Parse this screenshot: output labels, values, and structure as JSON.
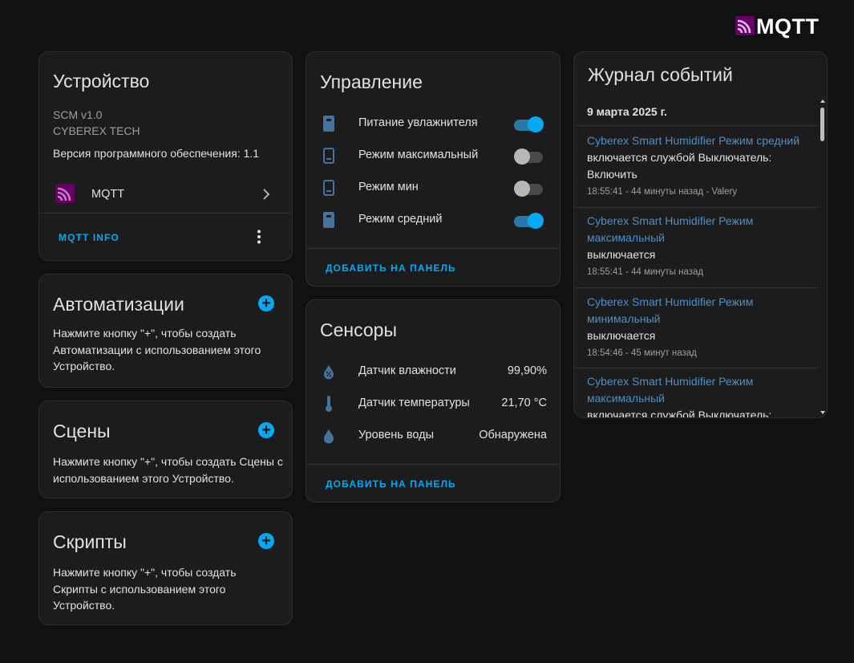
{
  "brand": {
    "logo_text": "MQTT"
  },
  "device_card": {
    "title": "Устройство",
    "model": "SCM v1.0",
    "manufacturer": "CYBEREX TECH",
    "firmware": "Версия программного обеспечения: 1.1",
    "integration_label": "MQTT",
    "info_button": "MQTT INFO"
  },
  "automations_card": {
    "title": "Автоматизации",
    "description": "Нажмите кнопку \"+\", чтобы создать Автоматизации с использованием этого Устройство."
  },
  "scenes_card": {
    "title": "Сцены",
    "description": "Нажмите кнопку \"+\", чтобы создать Сцены с использованием этого Устройство."
  },
  "scripts_card": {
    "title": "Скрипты",
    "description": "Нажмите кнопку \"+\", чтобы создать Скрипты с использованием этого Устройство."
  },
  "controls_card": {
    "title": "Управление",
    "items": [
      {
        "label": "Питание увлажнителя",
        "state": "on",
        "icon": "humidifier-on-icon"
      },
      {
        "label": "Режим максимальный",
        "state": "off",
        "icon": "humidifier-off-icon"
      },
      {
        "label": "Режим мин",
        "state": "off",
        "icon": "humidifier-off-icon"
      },
      {
        "label": "Режим средний",
        "state": "on",
        "icon": "humidifier-on-icon"
      }
    ],
    "add_button": "ДОБАВИТЬ НА ПАНЕЛЬ"
  },
  "sensors_card": {
    "title": "Сенсоры",
    "items": [
      {
        "label": "Датчик влажности",
        "value": "99,90%",
        "icon": "water-percent-icon"
      },
      {
        "label": "Датчик температуры",
        "value": "21,70 °C",
        "icon": "thermometer-icon"
      },
      {
        "label": "Уровень воды",
        "value": "Обнаружена",
        "icon": "water-drop-icon"
      }
    ],
    "add_button": "ДОБАВИТЬ НА ПАНЕЛЬ"
  },
  "logbook_card": {
    "title": "Журнал событий",
    "date": "9 марта 2025 г.",
    "entries": [
      {
        "entity": "Cyberex Smart Humidifier Режим средний",
        "message": "включается службой Выключатель: Включить",
        "meta": "18:55:41 - 44 минуты назад - Valery"
      },
      {
        "entity": "Cyberex Smart Humidifier Режим максимальный",
        "message": "выключается",
        "meta": "18:55:41 - 44 минуты назад"
      },
      {
        "entity": "Cyberex Smart Humidifier Режим минимальный",
        "message": "выключается",
        "meta": "18:54:46 - 45 минут назад"
      },
      {
        "entity": "Cyberex Smart Humidifier Режим максимальный",
        "message": "включается службой Выключатель:",
        "meta": ""
      }
    ]
  },
  "colors": {
    "accent": "#03a9f4",
    "card": "#1c1c1c",
    "background": "#111111",
    "mqtt_brand": "#660066"
  }
}
